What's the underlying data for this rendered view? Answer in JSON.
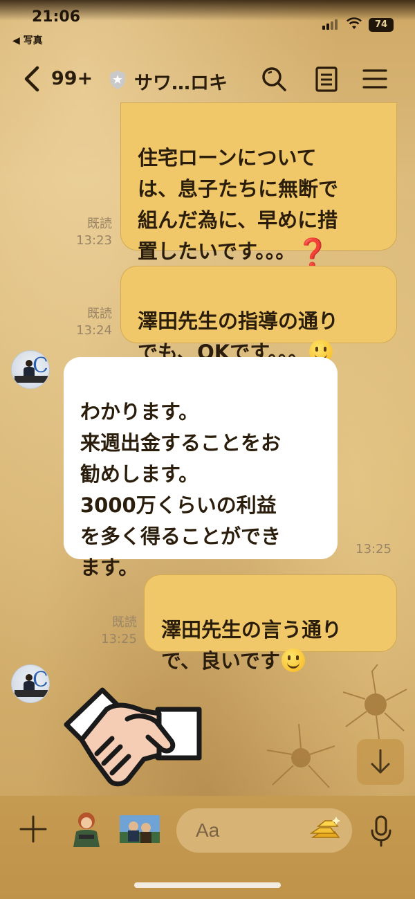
{
  "status_bar": {
    "time": "21:06",
    "back_app": "◀ 写真",
    "battery": "74"
  },
  "header": {
    "unread_count": "99+",
    "title": "サワ…ロキ",
    "icons": [
      "chevron-left-icon",
      "shield-icon",
      "search-icon",
      "notes-icon",
      "menu-icon"
    ]
  },
  "messages": [
    {
      "side": "me",
      "text": "住宅ローンについて\nは、息子たちに無断で\n組んだ為に、早めに措\n置したいです。。。",
      "read": "既読",
      "time": "13:23",
      "emoji": "question-mark"
    },
    {
      "side": "me",
      "text": "澤田先生の指導の通り\nでも、OKです。。。",
      "read": "既読",
      "time": "13:24",
      "emoji": "smiley"
    },
    {
      "side": "them",
      "text": "わかります。\n来週出金することをお\n勧めします。\n3000万くらいの利益\nを多く得ることができ\nます。",
      "time": "13:25"
    },
    {
      "side": "me",
      "text": "澤田先生の言う通り\nで、良いです",
      "read": "既読",
      "time": "13:25",
      "emoji": "smiley"
    },
    {
      "side": "them",
      "sticker": "handshake-sticker"
    }
  ],
  "input": {
    "placeholder": "Aa"
  },
  "colors": {
    "my_bubble": "#f1c869",
    "their_bubble": "#ffffff",
    "background": "#d7b577",
    "input_bar": "#c59a51"
  }
}
